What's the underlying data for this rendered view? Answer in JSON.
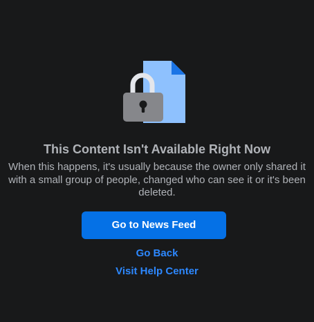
{
  "heading": "This Content Isn't Available Right Now",
  "message": "When this happens, it's usually because the owner only shared it with a small group of people, changed who can see it or it's been deleted.",
  "actions": {
    "news_feed": "Go to News Feed",
    "go_back": "Go Back",
    "help_center": "Visit Help Center"
  },
  "illustration": {
    "icon": "lock-document-icon",
    "colors": {
      "document": "#8ec1fe",
      "document_fold": "#1a74e6",
      "lock_body": "#86878b",
      "lock_shackle": "#e4e6eb",
      "keyhole": "#18191a"
    }
  },
  "colors": {
    "background": "#18191a",
    "text_secondary": "#b0b3b8",
    "primary_button": "#0571e6",
    "link": "#2d88ff"
  }
}
